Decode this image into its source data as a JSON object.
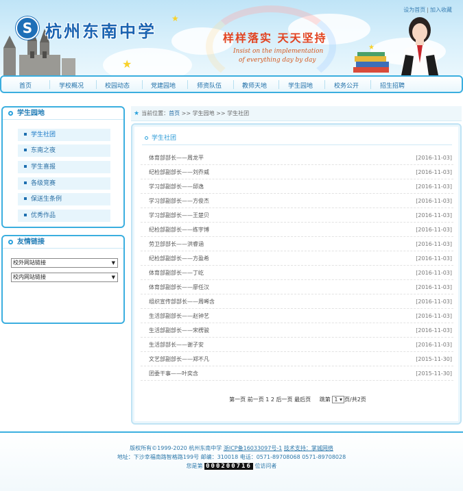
{
  "header": {
    "top_links": [
      "设为首页",
      "加入收藏"
    ],
    "school_name": "杭州东南中学",
    "logo_glyph": "S",
    "slogan_cn": "样样落实 天天坚持",
    "slogan_en_line1": "Insist on the implementation",
    "slogan_en_line2": "of everything day by day"
  },
  "nav": [
    "首页",
    "学校概况",
    "校园动态",
    "党建园地",
    "师资队伍",
    "教师天地",
    "学生园地",
    "校务公开",
    "招生招聘"
  ],
  "sidebar": {
    "section1_title": "学生园地",
    "items": [
      "学生社团",
      "东南之夜",
      "学生喜报",
      "各级竞赛",
      "保送生条例",
      "优秀作品"
    ],
    "section2_title": "友情链接",
    "selects": [
      "校外网站链接",
      "校内网站链接"
    ]
  },
  "breadcrumb": {
    "label": "当前位置：",
    "home": "首页",
    "sep1": ">>",
    "level2": "学生园地",
    "sep2": ">>",
    "level3": "学生社团"
  },
  "content": {
    "title": "学生社团",
    "rows": [
      {
        "title": "体育部部长——周龙平",
        "date": "[2016-11-03]"
      },
      {
        "title": "纪检部副部长——刘乔威",
        "date": "[2016-11-03]"
      },
      {
        "title": "学习部副部长——邱逸",
        "date": "[2016-11-03]"
      },
      {
        "title": "学习部副部长——方俊杰",
        "date": "[2016-11-03]"
      },
      {
        "title": "学习部副部长——王楚贝",
        "date": "[2016-11-03]"
      },
      {
        "title": "纪检部副部长——练宇博",
        "date": "[2016-11-03]"
      },
      {
        "title": "劳卫部部长——洪睿涵",
        "date": "[2016-11-03]"
      },
      {
        "title": "纪检部副部长——方盈希",
        "date": "[2016-11-03]"
      },
      {
        "title": "体育部副部长——丁屹",
        "date": "[2016-11-03]"
      },
      {
        "title": "体育部副部长——廖任汉",
        "date": "[2016-11-03]"
      },
      {
        "title": "组织宣传部部长——周晞含",
        "date": "[2016-11-03]"
      },
      {
        "title": "生活部副部长——赵钟艺",
        "date": "[2016-11-03]"
      },
      {
        "title": "生活部副部长——宋楞骏",
        "date": "[2016-11-03]"
      },
      {
        "title": "生活部部长——谢子安",
        "date": "[2016-11-03]"
      },
      {
        "title": "文艺部副部长——郑不凡",
        "date": "[2015-11-30]"
      },
      {
        "title": "团委干事——叶奕含",
        "date": "[2015-11-30]"
      }
    ],
    "pager": {
      "first": "第一页",
      "prev": "前一页",
      "p1": "1",
      "p2": "2",
      "next": "后一页",
      "last": "最后页",
      "goto_label": "跳第",
      "selected_page": "1",
      "suffix": "页/共2页"
    }
  },
  "footer": {
    "copyright": "版权所有©1999-2020 杭州东南中学",
    "icp": "浙ICP备16033097号-1",
    "support": "技术支持：掌城网络",
    "address": "地址：下沙幸福南路智格路199号 邮编：310018 电话：0571-89708068 0571-89708028",
    "visitor_prefix": "您是第",
    "visitor_count": "000200716",
    "visitor_suffix": "位访问者"
  },
  "colors": {
    "accent": "#3aaedf",
    "link": "#2a6fa4",
    "school_name": "#1a63b1",
    "slogan": "#e2421f"
  }
}
